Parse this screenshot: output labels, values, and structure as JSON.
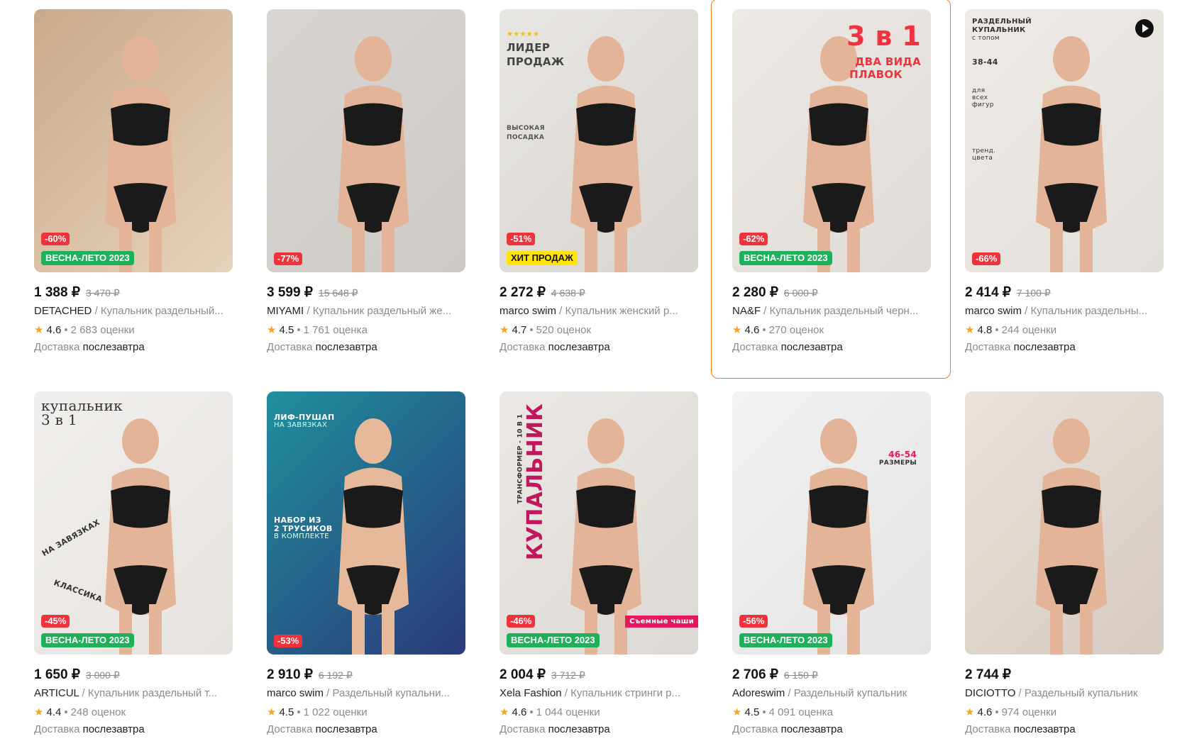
{
  "products": [
    {
      "price": "1 388 ₽",
      "old_price": "3 470 ₽",
      "brand": "DETACHED",
      "name": "Купальник раздельный...",
      "rating": "4.6",
      "reviews": "2 683 оценки",
      "delivery_label": "Доставка",
      "delivery_date": "послезавтра",
      "discount": "-60%",
      "label": "ВЕСНА-ЛЕТО 2023",
      "label_color": "green",
      "bg": [
        "#c9a98a",
        "#e8d2bb"
      ]
    },
    {
      "price": "3 599 ₽",
      "old_price": "15 648 ₽",
      "brand": "MIYAMI",
      "name": "Купальник раздельный же...",
      "rating": "4.5",
      "reviews": "1 761 оценка",
      "delivery_label": "Доставка",
      "delivery_date": "послезавтра",
      "discount": "-77%",
      "label": "",
      "label_color": "",
      "bg": [
        "#d8d5d2",
        "#cfcac6"
      ]
    },
    {
      "price": "2 272 ₽",
      "old_price": "4 638 ₽",
      "brand": "marco swim",
      "name": "Купальник женский р...",
      "rating": "4.7",
      "reviews": "520 оценок",
      "delivery_label": "Доставка",
      "delivery_date": "послезавтра",
      "discount": "-51%",
      "label": "ХИТ ПРОДАЖ",
      "label_color": "yellow",
      "bg": [
        "#e8e6e2",
        "#d8d4cf"
      ],
      "overlay": [
        "★★★★★",
        "ЛИДЕР",
        "ПРОДАЖ",
        "ВЫСОКАЯ",
        "ПОСАДКА"
      ]
    },
    {
      "price": "2 280 ₽",
      "old_price": "6 000 ₽",
      "brand": "NA&F",
      "name": "Купальник раздельный черн...",
      "rating": "4.6",
      "reviews": "270 оценок",
      "delivery_label": "Доставка",
      "delivery_date": "послезавтра",
      "discount": "-62%",
      "label": "ВЕСНА-ЛЕТО 2023",
      "label_color": "green",
      "bg": [
        "#ece8e4",
        "#e0dbd6"
      ],
      "overlay": [
        "3 в 1",
        "ДВА ВИДА",
        "ПЛАВОК"
      ]
    },
    {
      "price": "2 414 ₽",
      "old_price": "7 100 ₽",
      "brand": "marco swim",
      "name": "Купальник раздельны...",
      "rating": "4.8",
      "reviews": "244 оценки",
      "delivery_label": "Доставка",
      "delivery_date": "послезавтра",
      "discount": "-66%",
      "label": "",
      "label_color": "",
      "bg": [
        "#eeebe7",
        "#e2ded9"
      ],
      "overlay": [
        "РАЗДЕЛЬНЫЙ",
        "КУПАЛЬНИК",
        "с топом",
        "38-44",
        "для",
        "всех",
        "фигур",
        "тренд.",
        "цвета"
      ]
    },
    {
      "price": "1 650 ₽",
      "old_price": "3 000 ₽",
      "brand": "ARTICUL",
      "name": "Купальник раздельный т...",
      "rating": "4.4",
      "reviews": "248 оценок",
      "delivery_label": "Доставка",
      "delivery_date": "послезавтра",
      "discount": "-45%",
      "label": "ВЕСНА-ЛЕТО 2023",
      "label_color": "green",
      "bg": [
        "#f1efed",
        "#e6e2de"
      ],
      "overlay": [
        "купальник",
        "3 в 1",
        "НА ЗАВЯЗКАХ",
        "КЛАССИКА"
      ]
    },
    {
      "price": "2 910 ₽",
      "old_price": "6 192 ₽",
      "brand": "marco swim",
      "name": "Раздельный купальни...",
      "rating": "4.5",
      "reviews": "1 022 оценки",
      "delivery_label": "Доставка",
      "delivery_date": "послезавтра",
      "discount": "-53%",
      "label": "",
      "label_color": "",
      "bg": [
        "#1f8f9c",
        "#2b3a7a"
      ],
      "overlay": [
        "ЛИФ-ПУШАП",
        "НА ЗАВЯЗКАХ",
        "НАБОР ИЗ",
        "2 ТРУСИКОВ",
        "В КОМПЛЕКТЕ"
      ]
    },
    {
      "price": "2 004 ₽",
      "old_price": "3 712 ₽",
      "brand": "Xela Fashion",
      "name": "Купальник стринги р...",
      "rating": "4.6",
      "reviews": "1 044 оценки",
      "delivery_label": "Доставка",
      "delivery_date": "послезавтра",
      "discount": "-46%",
      "label": "ВЕСНА-ЛЕТО 2023",
      "label_color": "green",
      "bg": [
        "#ebe8e5",
        "#dcd8d3"
      ],
      "overlay": [
        "КУПАЛЬНИК",
        "ТРАНСФОРМЕР - 10 В 1",
        "Съемные чаши"
      ]
    },
    {
      "price": "2 706 ₽",
      "old_price": "6 150 ₽",
      "brand": "Adoreswim",
      "name": "Раздельный купальник",
      "rating": "4.5",
      "reviews": "4 091 оценка",
      "delivery_label": "Доставка",
      "delivery_date": "послезавтра",
      "discount": "-56%",
      "label": "ВЕСНА-ЛЕТО 2023",
      "label_color": "green",
      "bg": [
        "#f2f2f2",
        "#e3e3e3"
      ],
      "overlay": [
        "46-54",
        "РАЗМЕРЫ"
      ]
    },
    {
      "price": "2 744 ₽",
      "old_price": "",
      "brand": "DICIOTTO",
      "name": "Раздельный купальник",
      "rating": "4.6",
      "reviews": "974 оценки",
      "delivery_label": "Доставка",
      "delivery_date": "послезавтра",
      "discount": "",
      "label": "",
      "label_color": "",
      "bg": [
        "#e9e2db",
        "#d6cbc1"
      ]
    }
  ],
  "separators": {
    "brand_name": " / ",
    "rating_reviews": " • "
  },
  "colors": {
    "accent_highlight": "#ff7a1a",
    "discount": "#f1323a",
    "label_green": "#1fb05b",
    "label_yellow": "#ffe500",
    "star": "#f5a623"
  }
}
